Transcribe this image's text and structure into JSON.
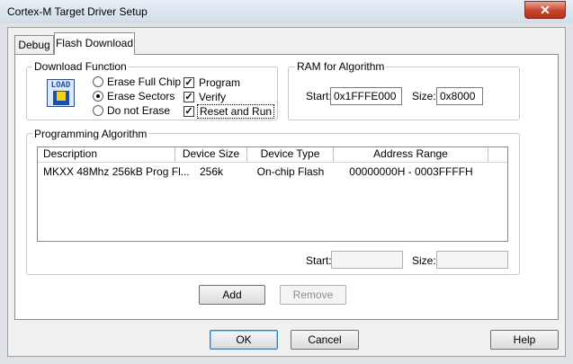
{
  "window": {
    "title": "Cortex-M Target Driver Setup",
    "close_glyph": "✕"
  },
  "tabs": [
    {
      "label": "Debug"
    },
    {
      "label": "Flash Download"
    }
  ],
  "download_function": {
    "title": "Download Function",
    "icon_text": "LOAD",
    "radios": [
      {
        "label": "Erase Full Chip",
        "selected": false
      },
      {
        "label": "Erase Sectors",
        "selected": true
      },
      {
        "label": "Do not Erase",
        "selected": false
      }
    ],
    "checks": [
      {
        "label": "Program",
        "checked": true
      },
      {
        "label": "Verify",
        "checked": true
      },
      {
        "label": "Reset and Run",
        "checked": true
      }
    ]
  },
  "ram": {
    "title": "RAM for Algorithm",
    "start_label": "Start:",
    "start_value": "0x1FFFE000",
    "size_label": "Size:",
    "size_value": "0x8000"
  },
  "algorithm": {
    "title": "Programming Algorithm",
    "columns": [
      "Description",
      "Device Size",
      "Device Type",
      "Address Range"
    ],
    "rows": [
      [
        "MKXX 48Mhz 256kB Prog Fl...",
        "256k",
        "On-chip Flash",
        "00000000H - 0003FFFFH"
      ]
    ],
    "start_label": "Start:",
    "start_value": "",
    "size_label": "Size:",
    "size_value": ""
  },
  "buttons": {
    "add": "Add",
    "remove": "Remove",
    "ok": "OK",
    "cancel": "Cancel",
    "help": "Help"
  },
  "colors": {
    "selection_blue": "#1e4fa8",
    "icon_yellow": "#f2d21b"
  }
}
